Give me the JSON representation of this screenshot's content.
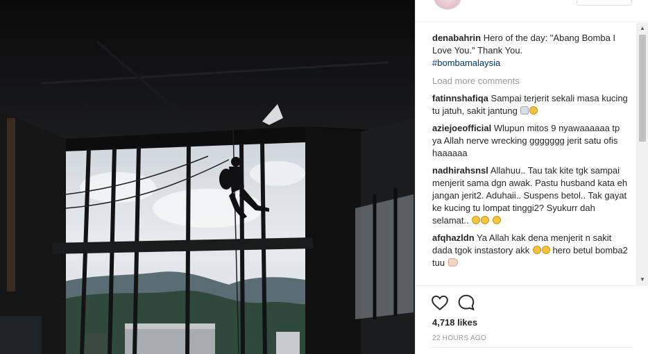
{
  "post": {
    "photo_alt": "Silhouette of a firefighter rappelling down a tall window overlooking hills",
    "likes": "4,718 likes",
    "timestamp": "22 HOURS AGO"
  },
  "caption": {
    "user": "denabahrin",
    "text": "Hero of the day: \"Abang Bomba I Love You.\" Thank You.",
    "hashtag": "#bombamalaysia"
  },
  "load_more": "Load more comments",
  "comments": [
    {
      "user": "fatinnshafiqa",
      "text": "Sampai terjerit sekali masa kucing tu jatuh, sakit jantung",
      "emojis": [
        "cat",
        "tears"
      ]
    },
    {
      "user": "aziejoeofficial",
      "text": "Wlupun mitos 9 nyawaaaaaa tp ya Allah nerve wrecking ggggggg jerit satu ofis haaaaaa",
      "emojis": []
    },
    {
      "user": "nadhirahsnsl",
      "text": "Allahuu.. Tau tak kite tgk sampai menjerit sama dgn awak. Pastu husband kata eh jangan jerit2. Aduhaii.. Suspens betol.. Tak gayat ke kucing tu lompat tinggi2? Syukurr dah selamat..",
      "emojis": [
        "relief",
        "relief",
        "relief"
      ]
    },
    {
      "user": "afqhazldn",
      "text": "Ya Allah kak dena menjerit n sakit dada tgok instastory akk",
      "emojis": [
        "grin",
        "wow"
      ],
      "tail": "hero betul bomba2 tuu",
      "tail_emoji": "arm"
    }
  ],
  "colors": {
    "username": "#262626",
    "hashtag": "#003569",
    "muted": "#999999",
    "divider": "#efefef"
  },
  "icons": {
    "like": "heart-icon",
    "comment": "comment-bubble-icon"
  }
}
